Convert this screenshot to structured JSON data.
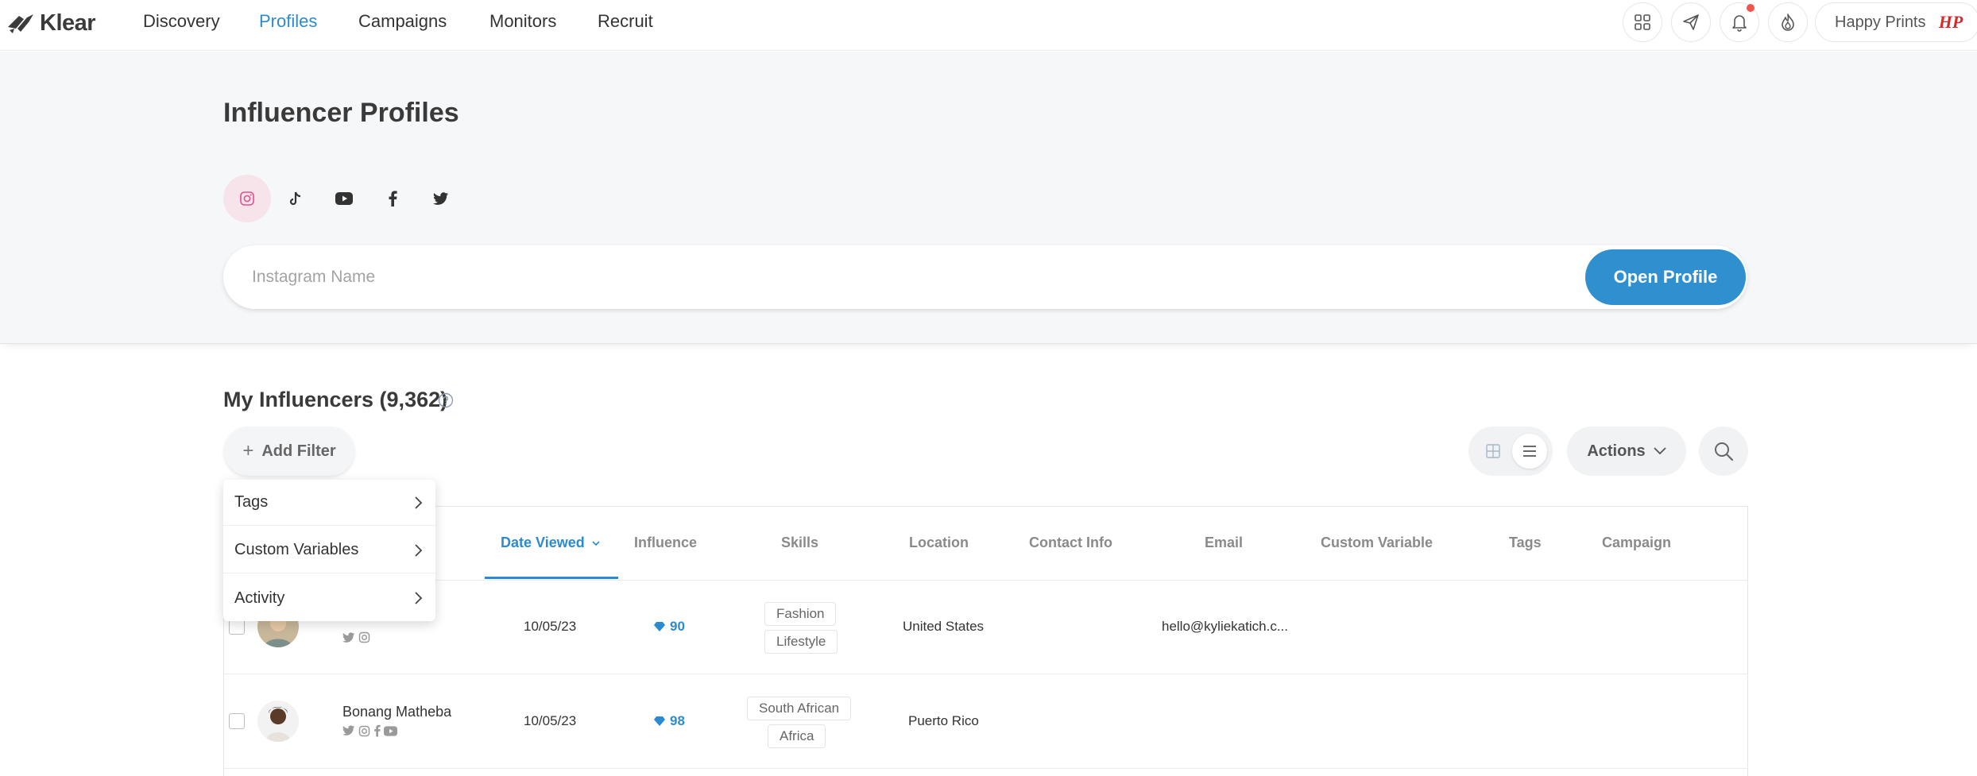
{
  "brand": {
    "name": "Klear"
  },
  "nav": {
    "links": [
      "Discovery",
      "Profiles",
      "Campaigns",
      "Monitors",
      "Recruit"
    ],
    "active": "Profiles"
  },
  "account": {
    "name": "Happy Prints",
    "logo_text": "HP"
  },
  "hero": {
    "title": "Influencer Profiles",
    "search_placeholder": "Instagram Name",
    "open_profile_label": "Open Profile",
    "platforms": [
      "instagram-icon",
      "tiktok-icon",
      "youtube-icon",
      "facebook-icon",
      "twitter-icon"
    ],
    "active_platform": "instagram-icon"
  },
  "list": {
    "title": "My Influencers (9,362)",
    "add_filter_label": "Add Filter",
    "actions_label": "Actions"
  },
  "filter_menu": {
    "items": [
      "Tags",
      "Custom Variables",
      "Activity"
    ]
  },
  "table": {
    "columns": [
      "Date Viewed",
      "Influence",
      "Skills",
      "Location",
      "Contact Info",
      "Email",
      "Custom Variable",
      "Tags",
      "Campaign"
    ],
    "sorted_column": "Date Viewed",
    "rows": [
      {
        "name": "",
        "date_viewed": "10/05/23",
        "influence": "90",
        "skills": [
          "Fashion",
          "Lifestyle"
        ],
        "location": "United States",
        "contact_info": "",
        "email": "hello@kyliekatich.c...",
        "socials": [
          "twitter-icon",
          "instagram-icon"
        ]
      },
      {
        "name": "Bonang Matheba",
        "date_viewed": "10/05/23",
        "influence": "98",
        "skills": [
          "South African",
          "Africa"
        ],
        "location": "Puerto Rico",
        "contact_info": "",
        "email": "",
        "socials": [
          "twitter-icon",
          "instagram-icon",
          "facebook-icon",
          "youtube-icon"
        ]
      }
    ]
  },
  "colors": {
    "accent": "#2a8bd0",
    "primary_button": "#2f8fcf",
    "hero_bg": "#f6f7f9",
    "notification": "#f2554d",
    "instagram_tab_bg": "#f6e4ea"
  }
}
